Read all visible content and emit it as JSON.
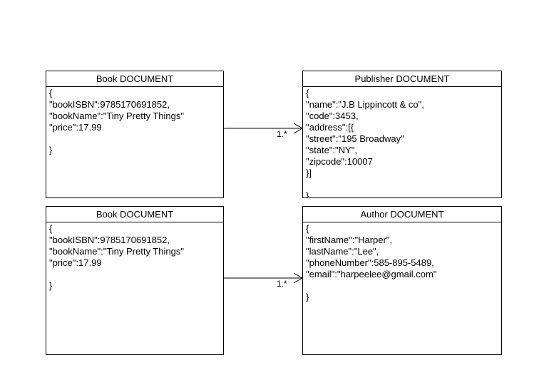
{
  "book_top": {
    "title": "Book DOCUMENT",
    "lines": [
      "{",
      "\"bookISBN\":9785170691852,",
      "\"bookName\":\"Tiny Pretty Things\"",
      "\"price\":17.99",
      "",
      "}"
    ]
  },
  "publisher": {
    "title": "Publisher DOCUMENT",
    "lines": [
      "{",
      "\"name\":\"J.B Lippincott & co\",",
      "\"code\":3453,",
      "\"address\":[{",
      "\"street\":\"195 Broadway\"",
      "\"state\":\"NY\",",
      "\"zipcode\":10007",
      "}]",
      "",
      "}"
    ]
  },
  "book_bottom": {
    "title": "Book DOCUMENT",
    "lines": [
      "{",
      "\"bookISBN\":9785170691852,",
      "\"bookName\":\"Tiny Pretty Things\"",
      "\"price\":17.99",
      "",
      "}"
    ]
  },
  "author": {
    "title": "Author DOCUMENT",
    "lines": [
      "{",
      "\"firstName\":\"Harper\",",
      "\"lastName\":\"Lee\",",
      "\"phoneNumber\":585-895-5489,",
      "\"email\":\"harpeelee@gmail.com\"",
      "",
      "}"
    ]
  },
  "relations": {
    "book_publisher_multiplicity": "1.*",
    "book_author_multiplicity": "1.*"
  }
}
